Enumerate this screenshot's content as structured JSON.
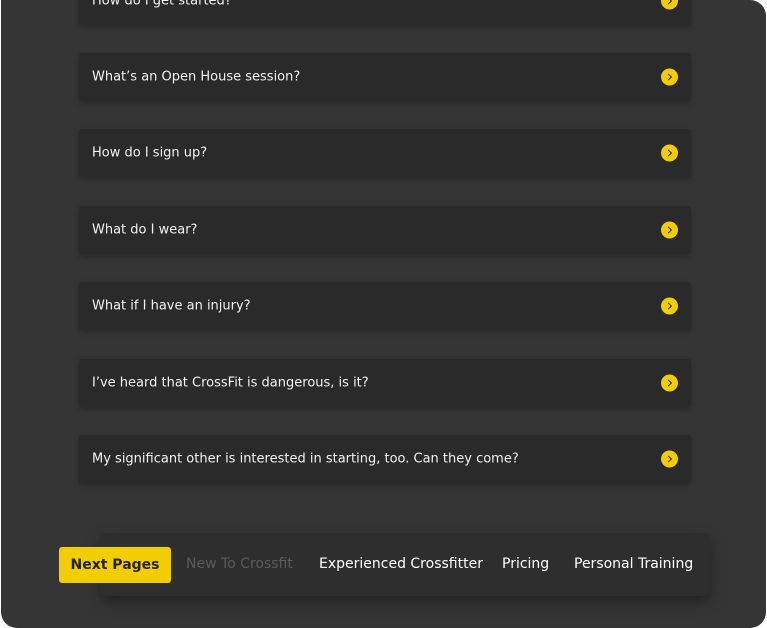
{
  "faq": {
    "items": [
      {
        "question": "How do I get started?"
      },
      {
        "question": "What’s an Open House session?"
      },
      {
        "question": "How do I sign up?"
      },
      {
        "question": "What do I wear?"
      },
      {
        "question": "What if I have an injury?"
      },
      {
        "question": "I’ve heard that CrossFit is dangerous, is it?"
      },
      {
        "question": "My significant other is interested in starting, too.  Can they come?"
      }
    ]
  },
  "nav": {
    "next_pages_label": "Next Pages",
    "links": [
      {
        "label": "New To Crossfit",
        "state": "disabled"
      },
      {
        "label": "Experienced Crossfitter",
        "state": "active"
      },
      {
        "label": "Pricing",
        "state": "active"
      },
      {
        "label": "Personal Training",
        "state": "active"
      }
    ]
  },
  "colors": {
    "accent": "#f2cd00",
    "background": "#353535",
    "card": "#2a2a2a"
  }
}
